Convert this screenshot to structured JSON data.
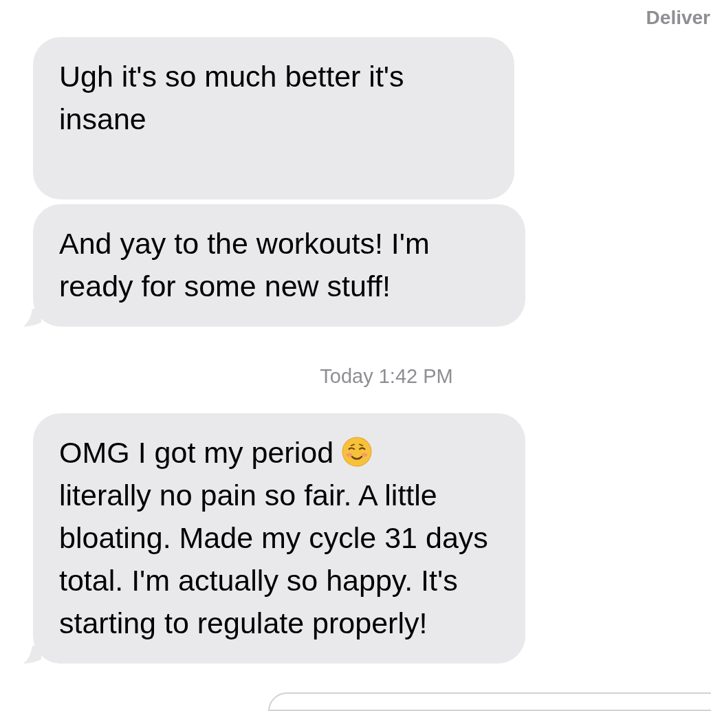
{
  "status": {
    "text": "Deliver"
  },
  "messages": [
    {
      "kind": "text",
      "text": "Ugh it's so much better it's insane",
      "tail": false
    },
    {
      "kind": "text",
      "text": "And yay to the workouts! I'm ready for some new stuff!",
      "tail": true
    },
    {
      "kind": "timestamp",
      "text": "Today 1:42 PM"
    },
    {
      "kind": "text",
      "text": "OMG I got my period",
      "emoji": true,
      "continuation": "literally no pain so fair. A little bloating. Made my cycle 31 days total. I'm actually so happy. It's starting to regulate properly!",
      "tail": true
    },
    {
      "kind": "outgoing_edge"
    }
  ]
}
